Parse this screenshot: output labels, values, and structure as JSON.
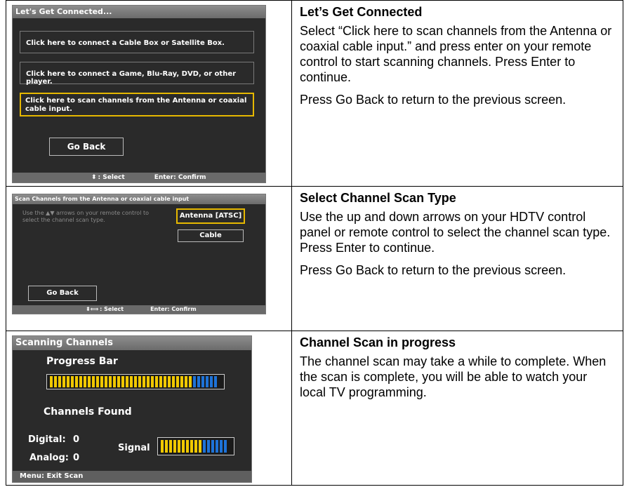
{
  "rows": [
    {
      "screen": {
        "title": "Let's Get Connected...",
        "options": [
          "Click here to connect a Cable Box or Satellite Box.",
          "Click here to connect a Game, Blu-Ray, DVD, or other player.",
          "Click here to scan channels from the Antenna or coaxial cable input."
        ],
        "selected_option": 2,
        "go_back": "Go Back",
        "footer_select": ": Select",
        "footer_confirm": "Enter: Confirm"
      },
      "heading": "Let’s Get Connected",
      "paragraphs": [
        "Select “Click here to scan channels from the Antenna or coaxial cable input.” and press enter on your remote control to start scanning channels. Press Enter to continue.",
        "Press Go Back to return to the previous screen."
      ]
    },
    {
      "screen": {
        "title": "Scan Channels from the Antenna or coaxial cable input",
        "instruction": "Use the ▲▼ arrows on your remote control to select the channel scan type.",
        "options": [
          "Antenna [ATSC]",
          "Cable"
        ],
        "selected_option": 0,
        "go_back": "Go Back",
        "footer_select": ": Select",
        "footer_confirm": "Enter: Confirm"
      },
      "heading": "Select Channel Scan Type",
      "paragraphs": [
        "Use the up and down arrows on your HDTV control panel or remote control to select the channel scan type. Press Enter to continue.",
        "Press Go Back to return to the previous screen."
      ]
    },
    {
      "screen": {
        "title": "Scanning Channels",
        "progress_label": "Progress Bar",
        "progress_fraction": 0.85,
        "channels_found_label": "Channels Found",
        "digital_label": "Digital:",
        "digital_value": "0",
        "analog_label": "Analog:",
        "analog_value": "0",
        "signal_label": "Signal",
        "signal_fraction": 0.6,
        "footer": "Menu: Exit Scan"
      },
      "heading": "Channel Scan in progress",
      "paragraphs": [
        "The channel scan may take a while to complete. When the scan is complete, you will be able to watch your local TV programming."
      ]
    }
  ],
  "colors": {
    "highlight": "#e6b800",
    "bar_yellow": "#f0c800",
    "bar_blue": "#1e73d8",
    "screen_bg": "#2a2a2a"
  }
}
